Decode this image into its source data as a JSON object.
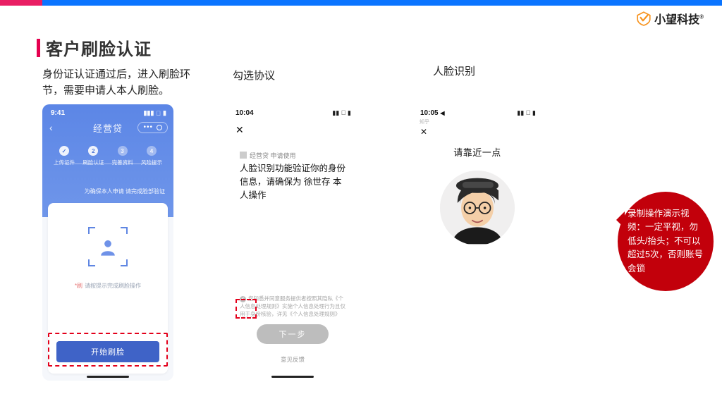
{
  "brand": {
    "name": "小望科技"
  },
  "title": "客户刷脸认证",
  "captions": {
    "c1": "身份证认证通过后，进入刷脸环节，需要申请人本人刷脸。",
    "c2": "勾选协议",
    "c3": "人脸识别"
  },
  "phone1": {
    "time": "9:41",
    "nav_title": "经营贷",
    "steps": {
      "s1": "上传证件",
      "s2": "刷脸认证",
      "s3": "完善资料",
      "s4": "风险提示"
    },
    "banner_sub": "为确保本人申请 请完成脸部验证",
    "hint_star": "*刷",
    "hint": "请按提示完成刷脸操作",
    "button": "开始刷脸"
  },
  "phone2": {
    "time": "10:04",
    "close": "✕",
    "source": "经营贷 申请使用",
    "message": "人脸识别功能验证你的身份信息，请确保为 徐世存 本人操作",
    "agree_pref": "✓",
    "agree_text": "您知悉并同意服务提供者按照其隐私《个人信息处理规则》实施个人信息处理行为且仅用于身份核验，详见《个人信息处理规则》",
    "next": "下一步",
    "feedback": "意见反馈"
  },
  "phone3": {
    "time": "10:05",
    "src": "知乎",
    "close": "✕",
    "prompt": "请靠近一点"
  },
  "bubble": "录制操作演示视频：一定平视，勿低头/抬头；不可以超过5次，否则账号会锁"
}
